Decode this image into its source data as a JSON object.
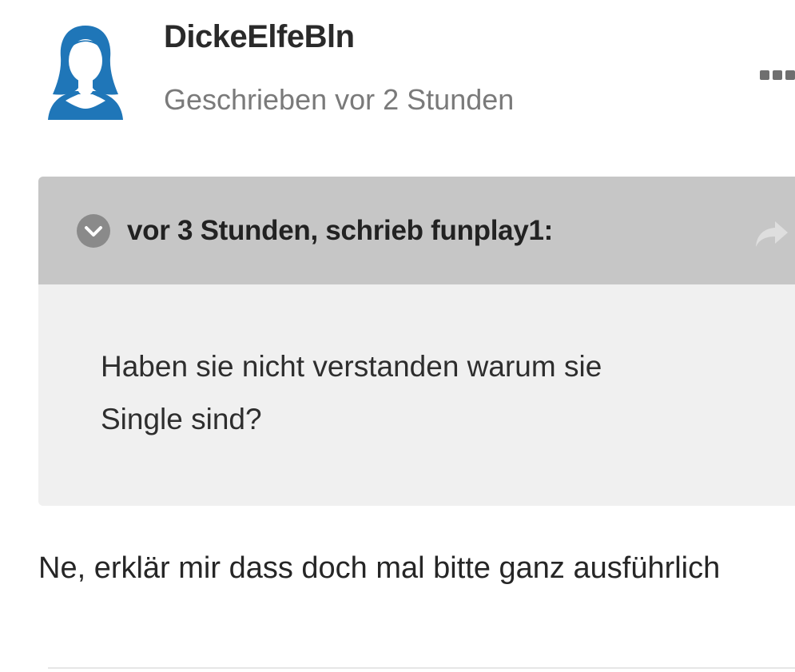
{
  "post": {
    "author": "DickeElfeBln",
    "timestamp": "Geschrieben vor 2 Stunden",
    "avatar_icon": "female-user-avatar-icon",
    "menu_icon": "more-dots-icon",
    "reply_text": "Ne, erklär mir dass doch mal bitte ganz ausführlich"
  },
  "quote": {
    "header": "vor 3 Stunden, schrieb funplay1:",
    "expand_icon": "chevron-down-circle-icon",
    "share_icon": "share-arrow-icon",
    "body_lines": [
      "Haben sie nicht verstanden warum sie",
      "Single sind?"
    ]
  },
  "colors": {
    "avatar_blue": "#1f76b8",
    "quote_header_bg": "#c6c6c6",
    "quote_body_bg": "#f0f0f0",
    "muted_text": "#7a7a7a"
  }
}
